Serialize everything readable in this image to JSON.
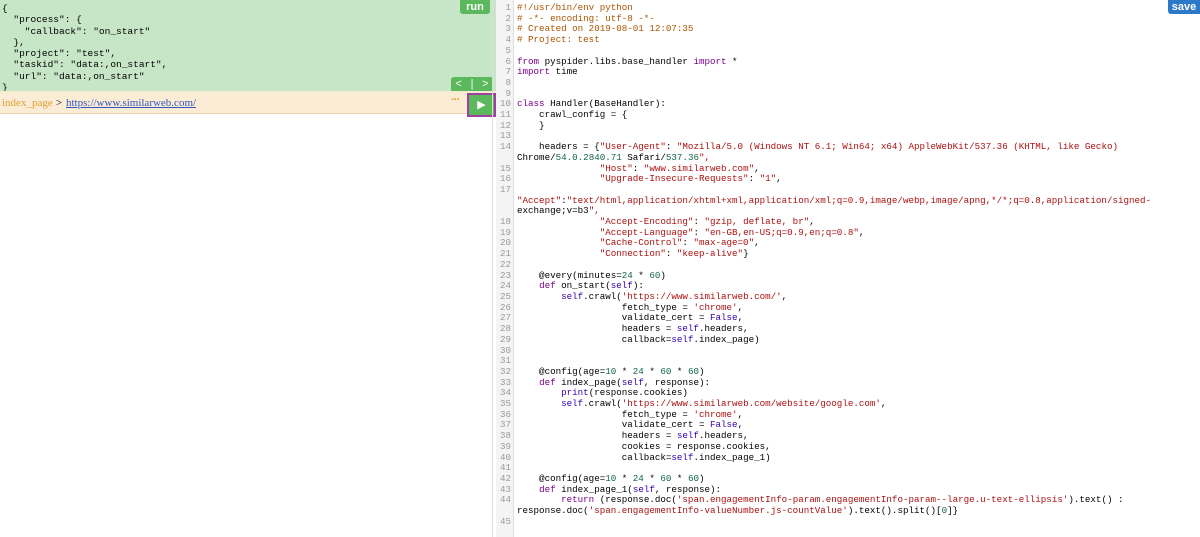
{
  "task": {
    "run_label": "run",
    "json_lines": [
      "{",
      "  \"process\": {",
      "    \"callback\": \"on_start\"",
      "  },",
      "  \"project\": \"test\",",
      "  \"taskid\": \"data:,on_start\",",
      "  \"url\": \"data:,on_start\"",
      "}"
    ],
    "prev_label": "<",
    "sep_label": "|",
    "next_label": ">"
  },
  "follow": {
    "callback": "index_page",
    "separator": ">",
    "url": "https://www.similarweb.com/",
    "more_label": "···",
    "play_label": "▶"
  },
  "editor": {
    "save_label": "save",
    "lines": [
      {
        "n": "1",
        "t": "#!/usr/bin/env python"
      },
      {
        "n": "2",
        "t": "# -*- encoding: utf-8 -*-"
      },
      {
        "n": "3",
        "t": "# Created on 2019-08-01 12:07:35"
      },
      {
        "n": "4",
        "t": "# Project: test"
      },
      {
        "n": "5",
        "t": ""
      },
      {
        "n": "6",
        "t": "from pyspider.libs.base_handler import *"
      },
      {
        "n": "7",
        "t": "import time"
      },
      {
        "n": "8",
        "t": ""
      },
      {
        "n": "9",
        "t": ""
      },
      {
        "n": "10",
        "t": "class Handler(BaseHandler):"
      },
      {
        "n": "11",
        "t": "    crawl_config = {"
      },
      {
        "n": "12",
        "t": "    }"
      },
      {
        "n": "13",
        "t": ""
      },
      {
        "n": "14",
        "t": "    headers = {\"User-Agent\": \"Mozilla/5.0 (Windows NT 6.1; Win64; x64) AppleWebKit/537.36 (KHTML, like Gecko)"
      },
      {
        "n": "",
        "t": "Chrome/54.0.2840.71 Safari/537.36\","
      },
      {
        "n": "15",
        "t": "               \"Host\": \"www.similarweb.com\","
      },
      {
        "n": "16",
        "t": "               \"Upgrade-Insecure-Requests\": \"1\","
      },
      {
        "n": "17",
        "t": ""
      },
      {
        "n": "",
        "t": "\"Accept\":\"text/html,application/xhtml+xml,application/xml;q=0.9,image/webp,image/apng,*/*;q=0.8,application/signed-"
      },
      {
        "n": "",
        "t": "exchange;v=b3\","
      },
      {
        "n": "18",
        "t": "               \"Accept-Encoding\": \"gzip, deflate, br\","
      },
      {
        "n": "19",
        "t": "               \"Accept-Language\": \"en-GB,en-US;q=0.9,en;q=0.8\","
      },
      {
        "n": "20",
        "t": "               \"Cache-Control\": \"max-age=0\","
      },
      {
        "n": "21",
        "t": "               \"Connection\": \"keep-alive\"}"
      },
      {
        "n": "22",
        "t": ""
      },
      {
        "n": "23",
        "t": "    @every(minutes=24 * 60)"
      },
      {
        "n": "24",
        "t": "    def on_start(self):"
      },
      {
        "n": "25",
        "t": "        self.crawl('https://www.similarweb.com/',"
      },
      {
        "n": "26",
        "t": "                   fetch_type = 'chrome',"
      },
      {
        "n": "27",
        "t": "                   validate_cert = False,"
      },
      {
        "n": "28",
        "t": "                   headers = self.headers,"
      },
      {
        "n": "29",
        "t": "                   callback=self.index_page)"
      },
      {
        "n": "30",
        "t": ""
      },
      {
        "n": "31",
        "t": ""
      },
      {
        "n": "32",
        "t": "    @config(age=10 * 24 * 60 * 60)"
      },
      {
        "n": "33",
        "t": "    def index_page(self, response):"
      },
      {
        "n": "34",
        "t": "        print(response.cookies)"
      },
      {
        "n": "35",
        "t": "        self.crawl('https://www.similarweb.com/website/google.com',"
      },
      {
        "n": "36",
        "t": "                   fetch_type = 'chrome',"
      },
      {
        "n": "37",
        "t": "                   validate_cert = False,"
      },
      {
        "n": "38",
        "t": "                   headers = self.headers,"
      },
      {
        "n": "39",
        "t": "                   cookies = response.cookies,"
      },
      {
        "n": "40",
        "t": "                   callback=self.index_page_1)"
      },
      {
        "n": "41",
        "t": ""
      },
      {
        "n": "42",
        "t": "    @config(age=10 * 24 * 60 * 60)"
      },
      {
        "n": "43",
        "t": "    def index_page_1(self, response):"
      },
      {
        "n": "44",
        "t": "        return (response.doc('span.engagementInfo-param.engagementInfo-param--large.u-text-ellipsis').text() :"
      },
      {
        "n": "",
        "t": "response.doc('span.engagementInfo-valueNumber.js-countValue').text().split()[0]}"
      },
      {
        "n": "45",
        "t": ""
      }
    ]
  }
}
